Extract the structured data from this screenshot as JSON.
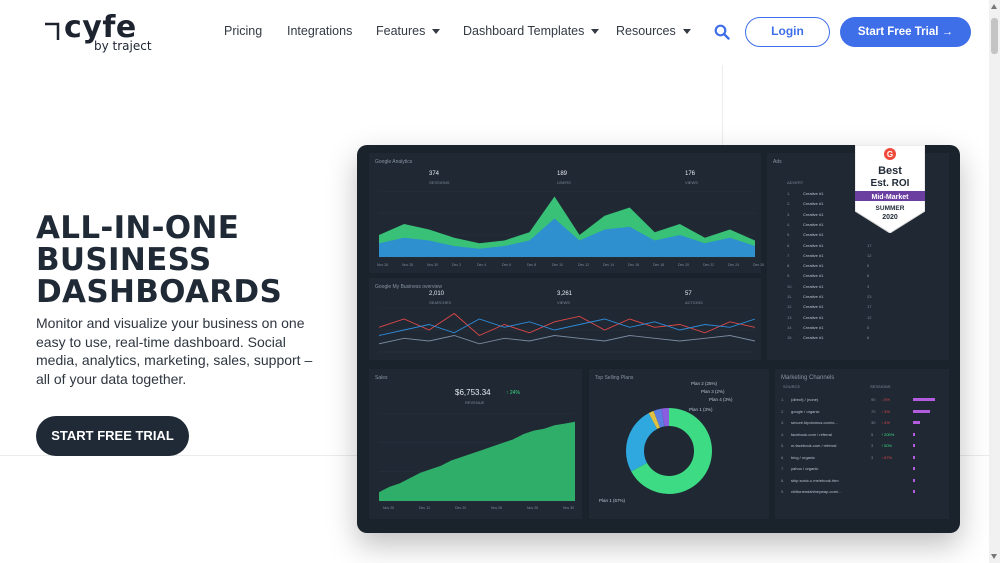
{
  "logo": {
    "word": "cyfe",
    "sub": "by traject"
  },
  "nav": {
    "items": [
      {
        "label": "Pricing",
        "dropdown": false
      },
      {
        "label": "Integrations",
        "dropdown": false
      },
      {
        "label": "Features",
        "dropdown": true
      },
      {
        "label": "Dashboard Templates",
        "dropdown": true
      },
      {
        "label": "Resources",
        "dropdown": true
      }
    ],
    "login_label": "Login",
    "trial_label": "Start Free Trial →"
  },
  "hero": {
    "title_lines": [
      "ALL-IN-ONE",
      "BUSINESS",
      "DASHBOARDS"
    ],
    "description": "Monitor and visualize your business on one easy to use, real-time dashboard. Social media, analytics, marketing, sales, support – all of your data together.",
    "cta_label": "START FREE TRIAL"
  },
  "badge": {
    "logo": "G",
    "line1": "Best",
    "line2": "Est. ROI",
    "ribbon": "Mid-Market",
    "season": "SUMMER",
    "year": "2020"
  },
  "colors": {
    "brand_blue": "#3f6fe8",
    "dark_navy": "#1f2a36",
    "dash_bg": "#1a222c",
    "green": "#3ddc84",
    "blue": "#2f8bd8",
    "badge_red": "#ef4b3c",
    "badge_purple": "#6b3fa0"
  },
  "icons": {
    "search": "search-icon",
    "caret": "caret-down-icon",
    "arrow": "arrow-right-icon"
  },
  "dashboard": {
    "analytics": {
      "title": "Google Analytics",
      "stats": [
        {
          "value": "374",
          "label": "SESSIONS"
        },
        {
          "value": "189",
          "label": "USERS"
        },
        {
          "value": "176",
          "label": "VIEWS"
        }
      ],
      "x_ticks": [
        "Nov 26",
        "Nov 28",
        "Nov 30",
        "Dec 2",
        "Dec 4",
        "Dec 6",
        "Dec 8",
        "Dec 10",
        "Dec 12",
        "Dec 14",
        "Dec 16",
        "Dec 18",
        "Dec 20",
        "Dec 22",
        "Dec 24",
        "Dec 26"
      ]
    },
    "business": {
      "title": "Google My Business overview",
      "stats": [
        {
          "value": "2,010",
          "label": "SEARCHES"
        },
        {
          "value": "3,261",
          "label": "VIEWS"
        },
        {
          "value": "57",
          "label": "ACTIONS"
        }
      ]
    },
    "ads": {
      "title": "Ads",
      "header": "ADVERT",
      "rows": [
        {
          "n": "1.",
          "name": "Creative #1",
          "v": ""
        },
        {
          "n": "2.",
          "name": "Creative #1",
          "v": ""
        },
        {
          "n": "3.",
          "name": "Creative #1",
          "v": ""
        },
        {
          "n": "4.",
          "name": "Creative #1",
          "v": ""
        },
        {
          "n": "5.",
          "name": "Creative #1",
          "v": ""
        },
        {
          "n": "6.",
          "name": "Creative #1",
          "v": "17"
        },
        {
          "n": "7.",
          "name": "Creative #1",
          "v": "12"
        },
        {
          "n": "8.",
          "name": "Creative #1",
          "v": "5"
        },
        {
          "n": "9.",
          "name": "Creative #1",
          "v": "8"
        },
        {
          "n": "10.",
          "name": "Creative #1",
          "v": "3"
        },
        {
          "n": "11.",
          "name": "Creative #1",
          "v": "23"
        },
        {
          "n": "12.",
          "name": "Creative #1",
          "v": "17"
        },
        {
          "n": "13.",
          "name": "Creative #1",
          "v": "12"
        },
        {
          "n": "14.",
          "name": "Creative #1",
          "v": "5"
        },
        {
          "n": "15.",
          "name": "Creative #1",
          "v": "8"
        }
      ]
    },
    "sales": {
      "title": "Sales",
      "value": "$6,753.34",
      "change": "↑ 24%",
      "label": "REVENUE",
      "x_ticks": [
        "Nov 26",
        "Dec 12",
        "Dec 20",
        "Nov 26",
        "Nov 26",
        "Nov 30"
      ]
    },
    "top_selling": {
      "title": "Top Selling Plans",
      "slices": [
        {
          "name": "Plan 1",
          "pct": 67,
          "label": "Plan 1 (67%)"
        },
        {
          "name": "Plan 2",
          "pct": 25,
          "label": "Plan 2 (25%)"
        },
        {
          "name": "Plan 3",
          "pct": 2,
          "label": "Plan 3 (2%)"
        },
        {
          "name": "Plan 4",
          "pct": 3,
          "label": "Plan 4 (3%)"
        },
        {
          "name": "Plan 1",
          "pct": 3,
          "label": "Plan 1 (3%)"
        }
      ]
    },
    "marketing": {
      "title": "Marketing Channels",
      "col_source": "SOURCE",
      "col_sessions": "SESSIONS",
      "rows": [
        {
          "source": "(direct) / (none)",
          "val": "90",
          "change": "↓ 5%",
          "up": false,
          "bar": 0.9
        },
        {
          "source": "google / organic",
          "val": "70",
          "change": "↓ 3%",
          "up": false,
          "bar": 0.7
        },
        {
          "source": "secure.bipolomus.com/o...",
          "val": "30",
          "change": "↓ 4%",
          "up": false,
          "bar": 0.3
        },
        {
          "source": "facebook.com / referral",
          "val": "5",
          "change": "↑ 200%",
          "up": true,
          "bar": 0.05
        },
        {
          "source": "m.facebook.com / referral",
          "val": "3",
          "change": "↑ 50%",
          "up": true,
          "bar": 0.03
        },
        {
          "source": "bing / organic",
          "val": "3",
          "change": "↓ 67%",
          "up": false,
          "bar": 0.03
        },
        {
          "source": "yahoo / organic",
          "val": "",
          "change": "",
          "up": true,
          "bar": 0.02
        },
        {
          "source": "ship.sonic-c.me/ebook.htm",
          "val": "",
          "change": "",
          "up": true,
          "bar": 0.02
        },
        {
          "source": "chiltonendahlneywap.com/...",
          "val": "",
          "change": "",
          "up": true,
          "bar": 0.02
        }
      ]
    }
  },
  "chart_data": [
    {
      "type": "area",
      "title": "Google Analytics",
      "categories": [
        "Nov 26",
        "Nov 28",
        "Nov 30",
        "Dec 2",
        "Dec 4",
        "Dec 6",
        "Dec 8",
        "Dec 10",
        "Dec 12",
        "Dec 14",
        "Dec 16",
        "Dec 18",
        "Dec 20",
        "Dec 22",
        "Dec 24",
        "Dec 26"
      ],
      "series": [
        {
          "name": "SESSIONS",
          "values": [
            8,
            12,
            10,
            7,
            5,
            6,
            9,
            22,
            8,
            15,
            18,
            9,
            12,
            7,
            10,
            6
          ]
        },
        {
          "name": "USERS",
          "values": [
            5,
            7,
            6,
            4,
            3,
            4,
            6,
            14,
            6,
            10,
            11,
            6,
            8,
            5,
            7,
            4
          ]
        }
      ]
    },
    {
      "type": "line",
      "title": "Google My Business overview",
      "series": [
        {
          "name": "SEARCHES",
          "values": [
            9,
            12,
            8,
            14,
            6,
            10,
            7,
            11,
            13,
            8,
            12,
            9,
            10,
            7,
            11,
            9
          ]
        },
        {
          "name": "VIEWS",
          "values": [
            6,
            8,
            10,
            7,
            12,
            9,
            11,
            8,
            10,
            12,
            9,
            11,
            8,
            10,
            9,
            12
          ]
        },
        {
          "name": "ACTIONS",
          "values": [
            3,
            5,
            4,
            6,
            3,
            5,
            4,
            6,
            5,
            4,
            6,
            5,
            4,
            5,
            6,
            4
          ]
        }
      ]
    },
    {
      "type": "area",
      "title": "Sales",
      "series": [
        {
          "name": "REVENUE",
          "values": [
            5,
            8,
            10,
            13,
            16,
            18,
            20,
            23,
            25,
            27,
            29,
            31,
            33,
            35,
            38,
            40,
            41,
            43,
            44,
            45
          ]
        }
      ]
    },
    {
      "type": "pie",
      "title": "Top Selling Plans",
      "categories": [
        "Plan 1",
        "Plan 2",
        "Plan 3",
        "Plan 4",
        "Plan 1"
      ],
      "values": [
        67,
        25,
        2,
        3,
        3
      ]
    }
  ]
}
